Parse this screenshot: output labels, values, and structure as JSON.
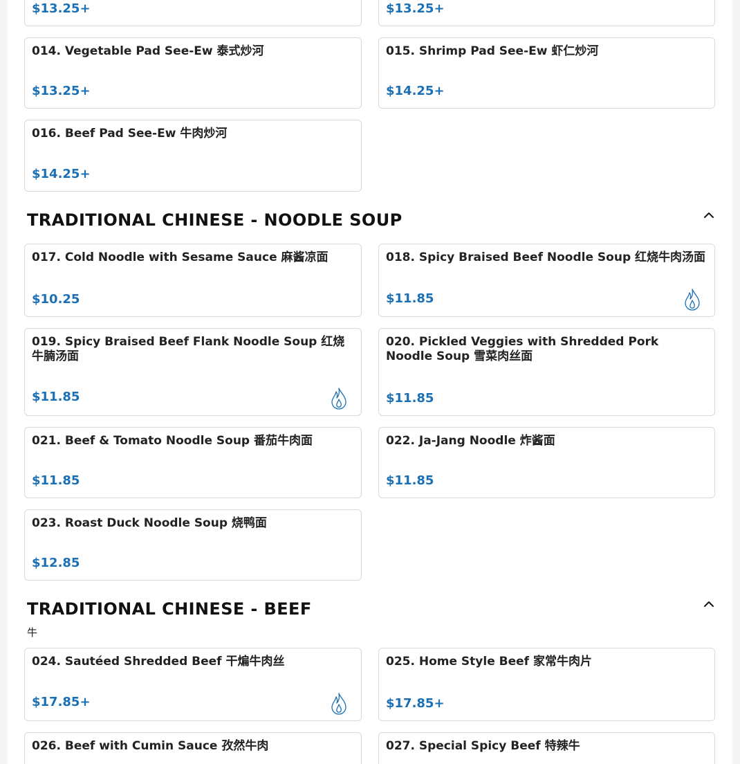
{
  "colors": {
    "price": "#1a6fb5",
    "spicy_icon": "#1a6fb5",
    "title": "#111111"
  },
  "items_top": [
    {
      "price": "$13.25+"
    },
    {
      "price": "$13.25+"
    }
  ],
  "section_pad_see_ew": {
    "items": [
      {
        "name": "014. Vegetable Pad See-Ew 泰式炒河",
        "price": "$13.25+"
      },
      {
        "name": "015. Shrimp Pad See-Ew 虾仁炒河",
        "price": "$14.25+"
      },
      {
        "name": "016. Beef Pad See-Ew 牛肉炒河",
        "price": "$14.25+"
      }
    ]
  },
  "section_noodle_soup": {
    "title": "TRADITIONAL CHINESE - NOODLE SOUP",
    "collapse_icon": "chevron-up-icon",
    "items": [
      {
        "name": "017. Cold Noodle with Sesame Sauce 麻酱凉面",
        "price": "$10.25",
        "spicy": false
      },
      {
        "name": "018. Spicy Braised Beef Noodle Soup 红烧牛肉汤面",
        "price": "$11.85",
        "spicy": true
      },
      {
        "name": "019. Spicy Braised Beef Flank Noodle Soup 红烧牛腩汤面",
        "price": "$11.85",
        "spicy": true
      },
      {
        "name": "020. Pickled Veggies with Shredded Pork Noodle Soup 雪菜肉丝面",
        "price": "$11.85",
        "spicy": false
      },
      {
        "name": "021. Beef & Tomato Noodle Soup 番茄牛肉面",
        "price": "$11.85",
        "spicy": false
      },
      {
        "name": "022. Ja-Jang Noodle 炸酱面",
        "price": "$11.85",
        "spicy": false
      },
      {
        "name": "023. Roast Duck Noodle Soup 烧鸭面",
        "price": "$12.85",
        "spicy": false
      }
    ]
  },
  "section_beef": {
    "title": "TRADITIONAL CHINESE - BEEF",
    "note": "牛",
    "collapse_icon": "chevron-up-icon",
    "items": [
      {
        "name": "024. Sautéed Shredded Beef 干煸牛肉丝",
        "price": "$17.85+",
        "spicy": true
      },
      {
        "name": "025. Home Style Beef 家常牛肉片",
        "price": "$17.85+",
        "spicy": false
      },
      {
        "name": "026. Beef with Cumin Sauce 孜然牛肉",
        "price": "",
        "spicy": false
      },
      {
        "name": "027. Special Spicy Beef 特辣牛",
        "price": "",
        "spicy": false
      }
    ]
  }
}
